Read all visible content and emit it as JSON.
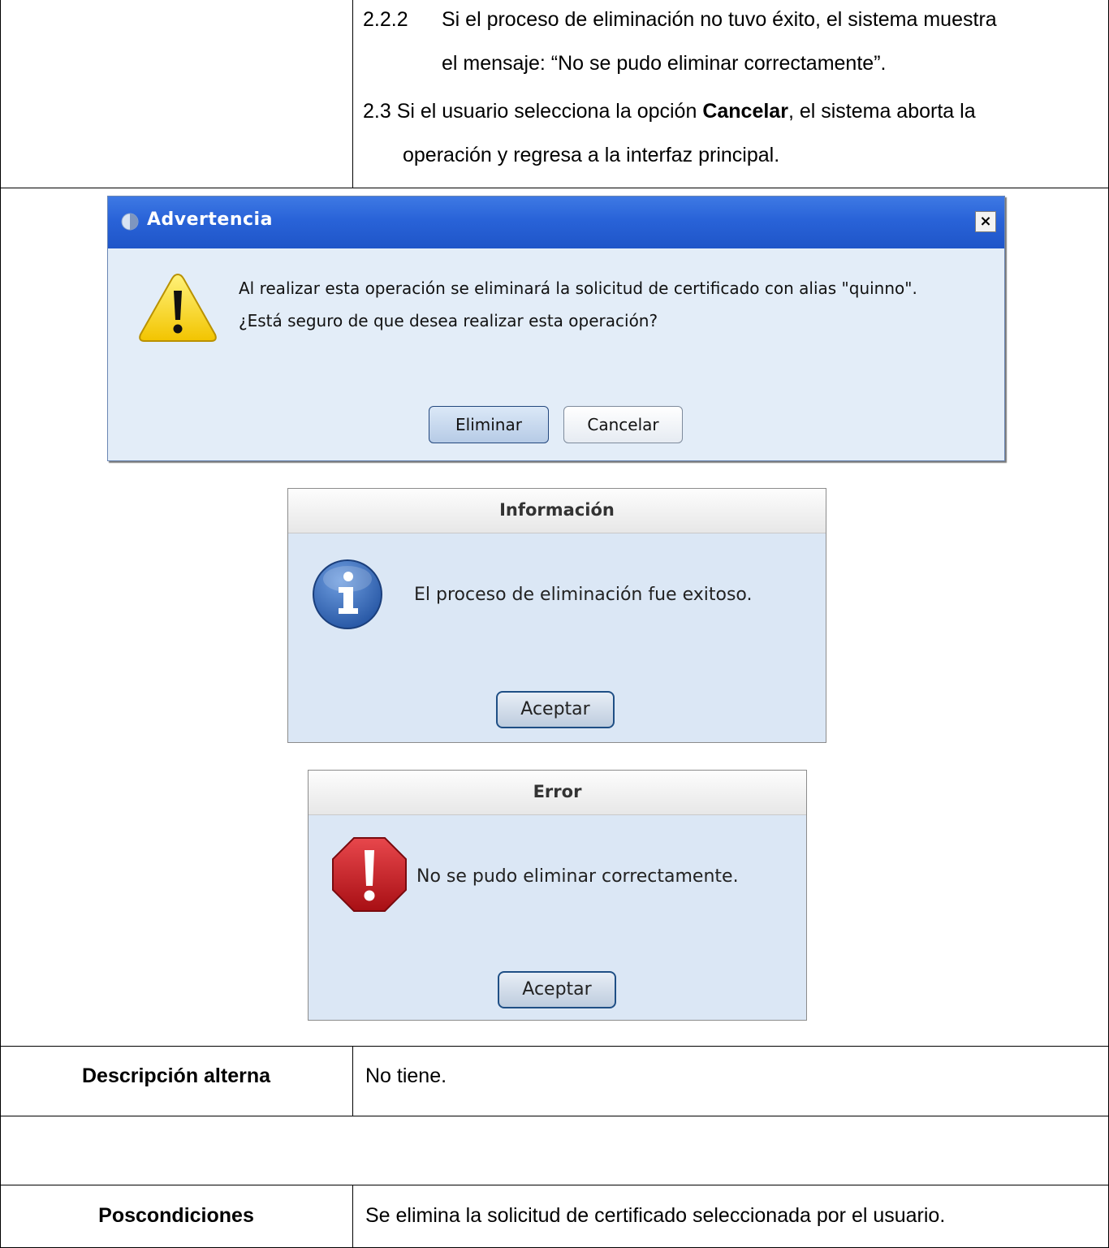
{
  "top_rows": {
    "item_222_number": "2.2.2",
    "item_222_line1": "Si el proceso de eliminación no tuvo éxito, el sistema muestra",
    "item_222_line2": "el mensaje: “No se pudo eliminar correctamente”.",
    "item_23_prefix": "2.3 Si el usuario selecciona la opción ",
    "item_23_bold": "Cancelar",
    "item_23_suffix": ", el sistema aborta la",
    "item_23_line2": "operación y regresa a la interfaz principal."
  },
  "warning_dialog": {
    "title": "Advertencia",
    "close_glyph": "×",
    "message_line1": "Al realizar esta operación se eliminará la solicitud de certificado con alias \"quinno\".",
    "message_line2": "¿Está seguro de que desea realizar esta operación?",
    "primary_button": "Eliminar",
    "secondary_button": "Cancelar",
    "icon": "warning-triangle-icon"
  },
  "info_dialog": {
    "title": "Información",
    "message": "El proceso de eliminación fue exitoso.",
    "button": "Aceptar",
    "icon": "info-icon"
  },
  "error_dialog": {
    "title": "Error",
    "message": "No se pudo eliminar correctamente.",
    "button": "Aceptar",
    "icon": "error-octagon-icon"
  },
  "alt_row": {
    "label": "Descripción alterna",
    "value": "No tiene."
  },
  "post_row": {
    "label": "Poscondiciones",
    "value": "Se elimina la solicitud de certificado seleccionada por el usuario."
  },
  "colors": {
    "warning_title_bar": "#2963d8",
    "dialog_body": "#e3edf8",
    "info_blue": "#2f66b8",
    "error_red": "#c0171d",
    "warning_yellow": "#f5d31a"
  }
}
